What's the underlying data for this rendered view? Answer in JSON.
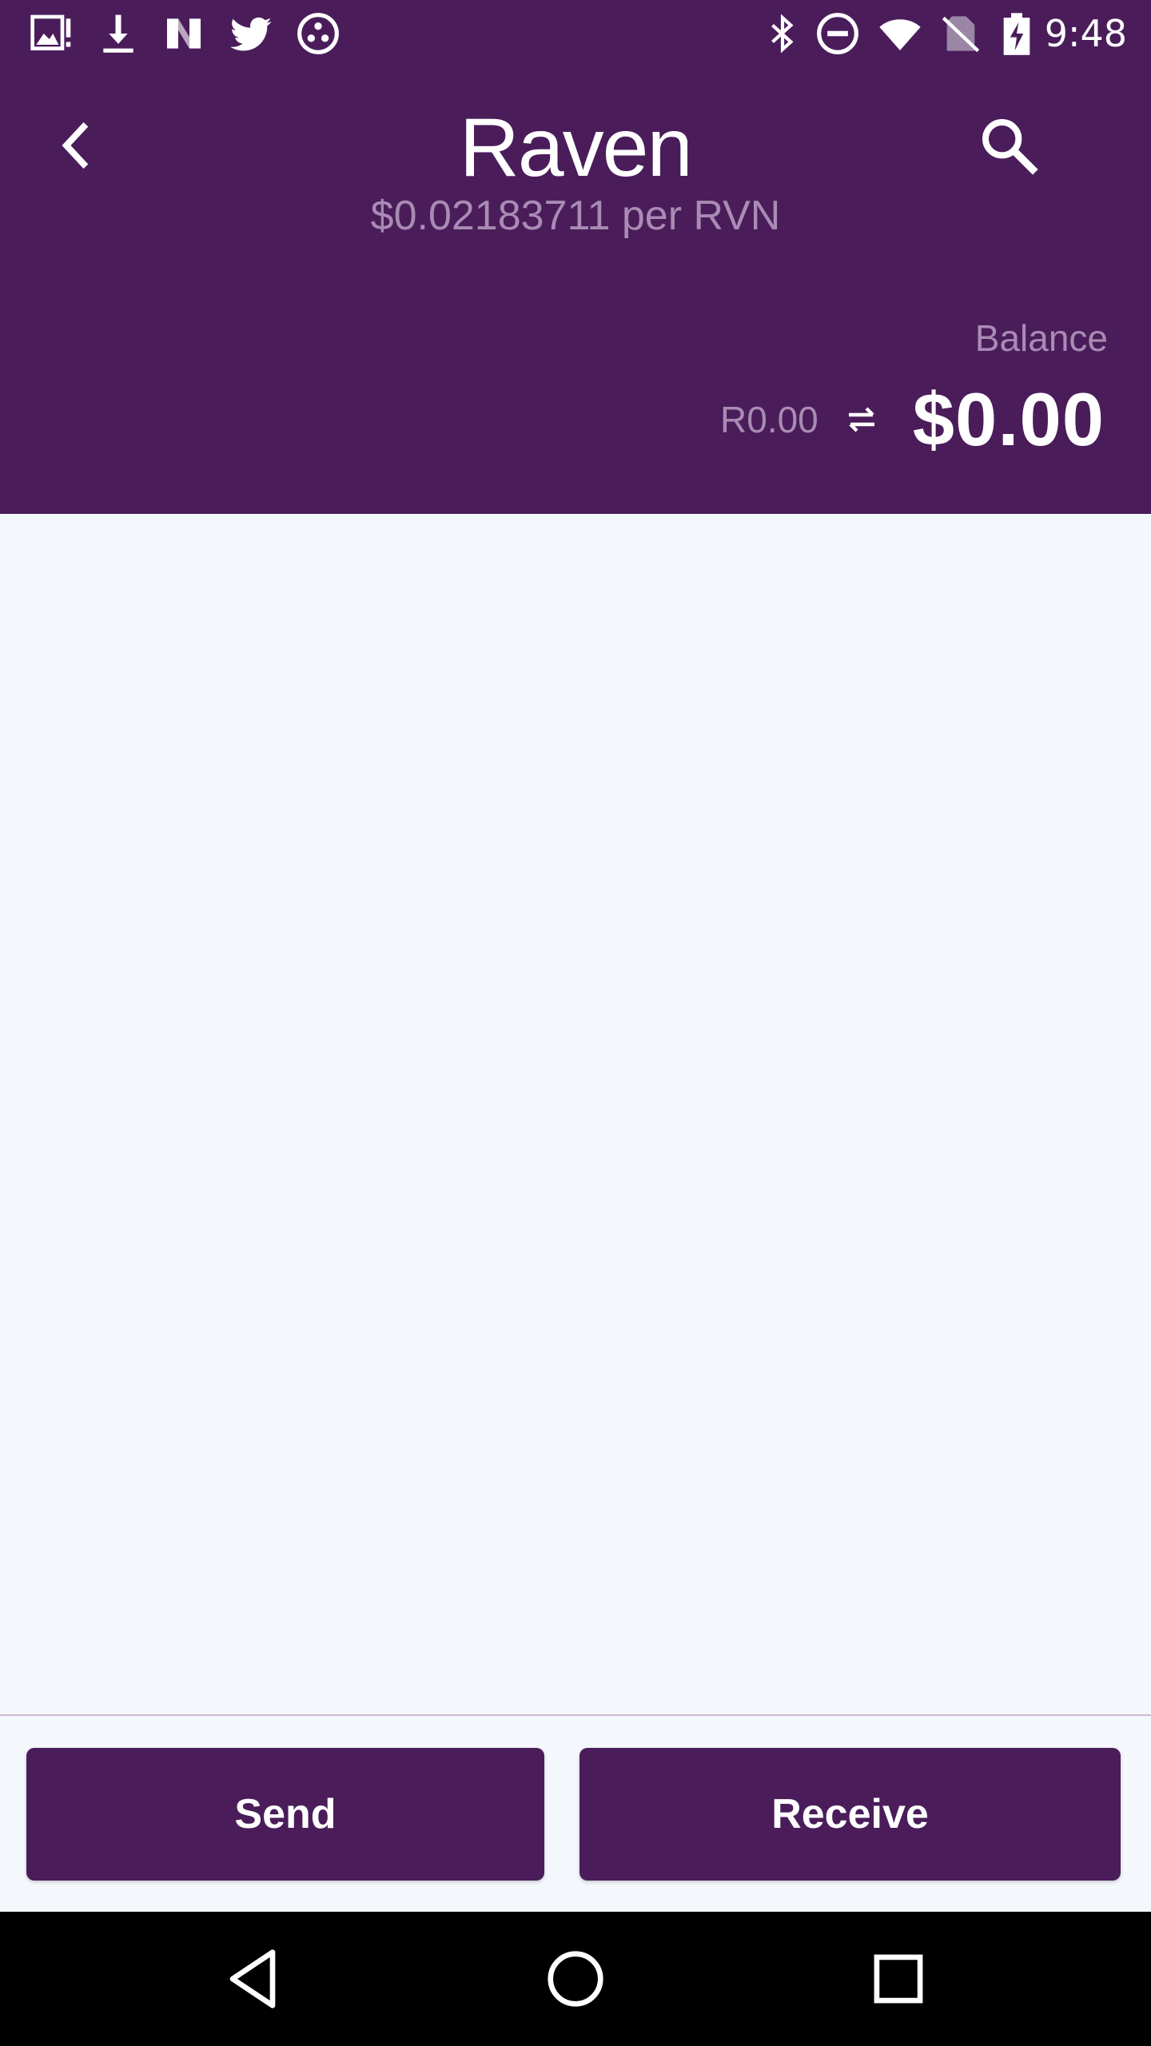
{
  "status_bar": {
    "time": "9:48",
    "left_icons": [
      "photo-alert-icon",
      "download-icon",
      "nova-icon",
      "twitter-icon",
      "dots-app-icon"
    ],
    "right_icons": [
      "bluetooth-icon",
      "do-not-disturb-icon",
      "wifi-icon",
      "no-sim-icon",
      "battery-charging-icon"
    ]
  },
  "header": {
    "app_name": "Raven",
    "price": "$0.02183711 per RVN",
    "balance_label": "Balance",
    "balance_crypto": "R0.00",
    "balance_fiat": "$0.00"
  },
  "actions": {
    "send_label": "Send",
    "receive_label": "Receive"
  },
  "colors": {
    "brand": "#4a1d5a",
    "muted": "#a98bb4",
    "background": "#f4f7fb"
  }
}
